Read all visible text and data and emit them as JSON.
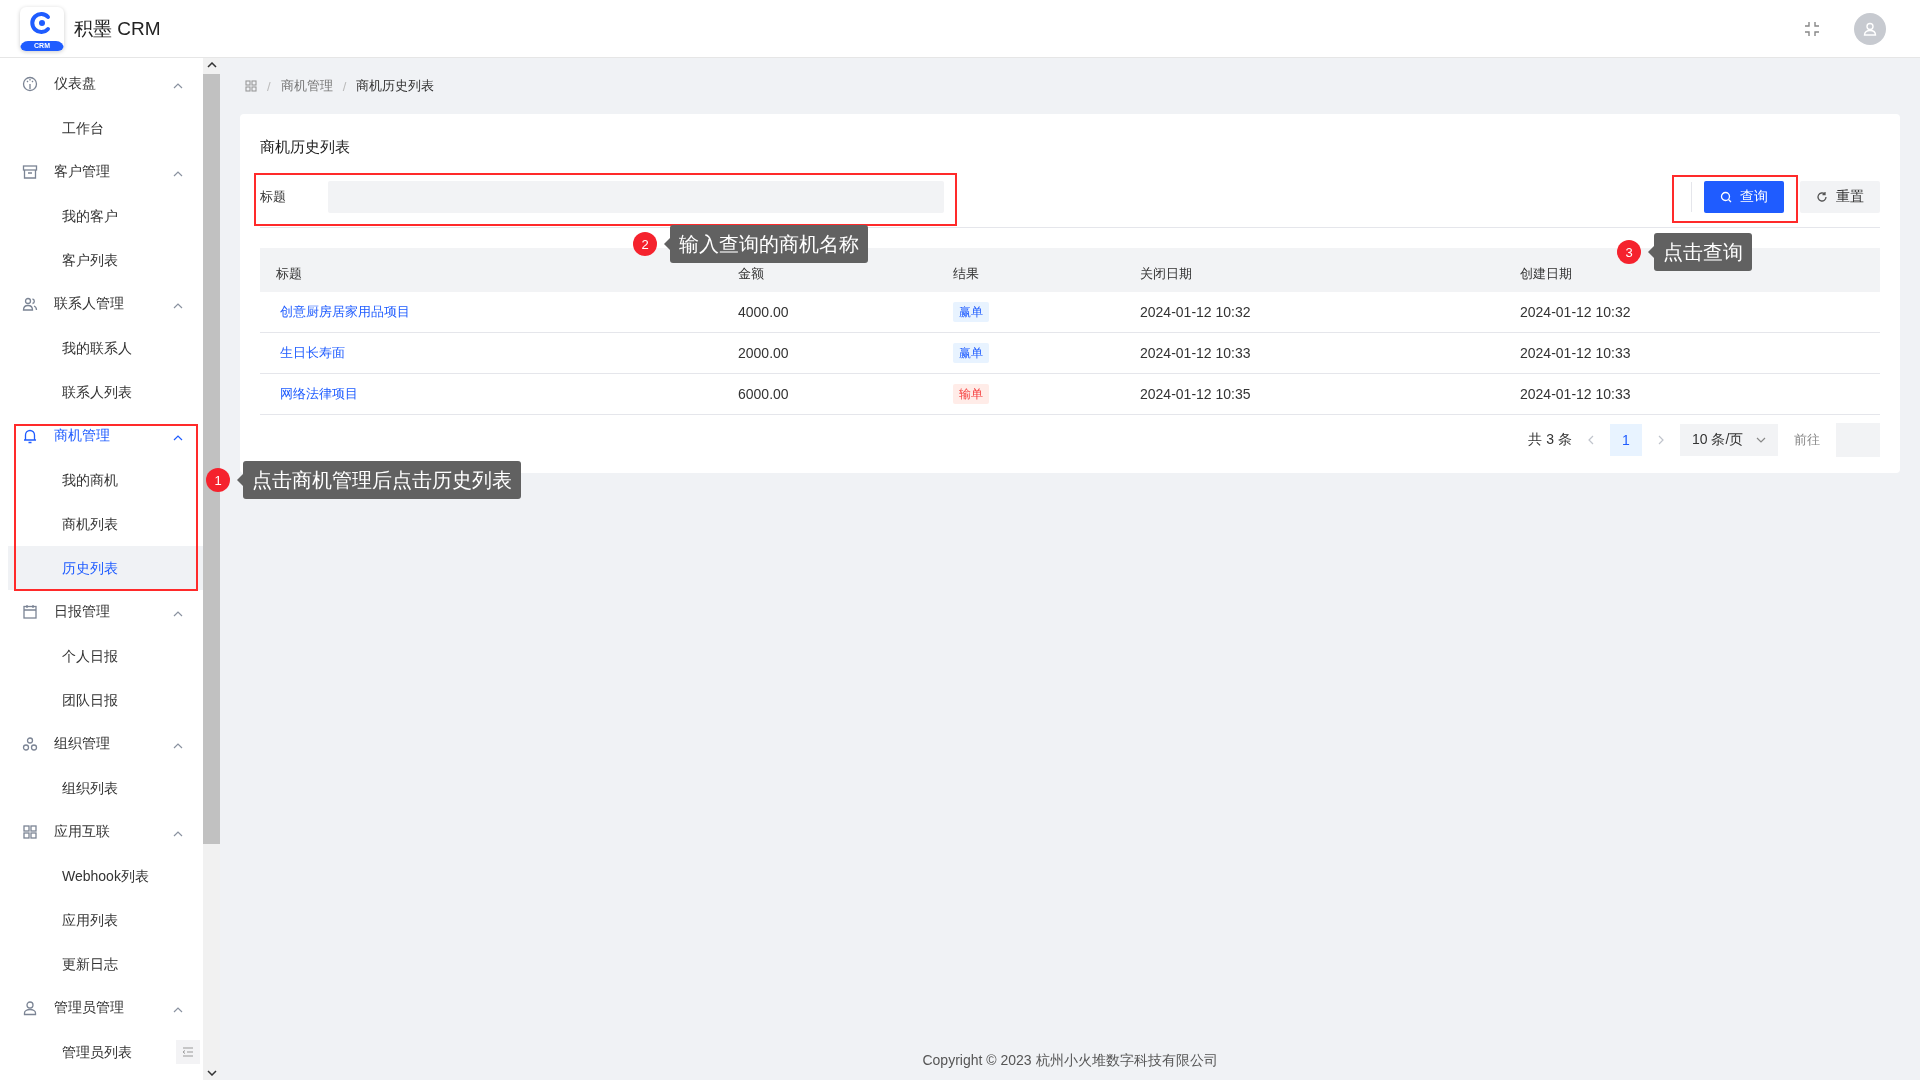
{
  "header": {
    "logo_badge": "CRM",
    "app_name": "积墨 CRM"
  },
  "sidebar": {
    "groups": [
      {
        "label": "仪表盘",
        "expanded": true,
        "active": false,
        "items": [
          {
            "label": "工作台",
            "selected": false
          }
        ]
      },
      {
        "label": "客户管理",
        "expanded": true,
        "active": false,
        "items": [
          {
            "label": "我的客户",
            "selected": false
          },
          {
            "label": "客户列表",
            "selected": false
          }
        ]
      },
      {
        "label": "联系人管理",
        "expanded": true,
        "active": false,
        "items": [
          {
            "label": "我的联系人",
            "selected": false
          },
          {
            "label": "联系人列表",
            "selected": false
          }
        ]
      },
      {
        "label": "商机管理",
        "expanded": true,
        "active": true,
        "items": [
          {
            "label": "我的商机",
            "selected": false
          },
          {
            "label": "商机列表",
            "selected": false
          },
          {
            "label": "历史列表",
            "selected": true
          }
        ]
      },
      {
        "label": "日报管理",
        "expanded": true,
        "active": false,
        "items": [
          {
            "label": "个人日报",
            "selected": false
          },
          {
            "label": "团队日报",
            "selected": false
          }
        ]
      },
      {
        "label": "组织管理",
        "expanded": true,
        "active": false,
        "items": [
          {
            "label": "组织列表",
            "selected": false
          }
        ]
      },
      {
        "label": "应用互联",
        "expanded": true,
        "active": false,
        "items": [
          {
            "label": "Webhook列表",
            "selected": false
          },
          {
            "label": "应用列表",
            "selected": false
          },
          {
            "label": "更新日志",
            "selected": false
          }
        ]
      },
      {
        "label": "管理员管理",
        "expanded": true,
        "active": false,
        "items": [
          {
            "label": "管理员列表",
            "selected": false
          }
        ]
      }
    ]
  },
  "breadcrumb": {
    "separator": "/",
    "items": [
      "商机管理",
      "商机历史列表"
    ]
  },
  "card": {
    "title": "商机历史列表",
    "filter": {
      "label": "标题"
    },
    "buttons": [
      {
        "kind": "primary",
        "label": "查询"
      },
      {
        "kind": "reset",
        "label": "重置"
      }
    ],
    "table": {
      "columns": [
        "标题",
        "金额",
        "结果",
        "关闭日期",
        "创建日期"
      ],
      "rows": [
        {
          "title": "创意厨房居家用品项目",
          "amount": "4000.00",
          "result": {
            "label": "赢单",
            "kind": "win"
          },
          "closed": "2024-01-12 10:32",
          "created": "2024-01-12 10:32"
        },
        {
          "title": "生日长寿面",
          "amount": "2000.00",
          "result": {
            "label": "赢单",
            "kind": "win"
          },
          "closed": "2024-01-12 10:33",
          "created": "2024-01-12 10:33"
        },
        {
          "title": "网络法律项目",
          "amount": "6000.00",
          "result": {
            "label": "输单",
            "kind": "lose"
          },
          "closed": "2024-01-12 10:35",
          "created": "2024-01-12 10:33"
        }
      ]
    },
    "pagination": {
      "total": "共 3 条",
      "pages": [
        {
          "label": "1",
          "selected": true
        }
      ],
      "page_size": "10 条/页",
      "goto": "前往"
    }
  },
  "footer": "Copyright © 2023 杭州小火堆数字科技有限公司",
  "callouts": [
    {
      "number": "1",
      "text": "点击商机管理后点击历史列表"
    },
    {
      "number": "2",
      "text": "输入查询的商机名称"
    },
    {
      "number": "3",
      "text": "点击查询"
    }
  ]
}
